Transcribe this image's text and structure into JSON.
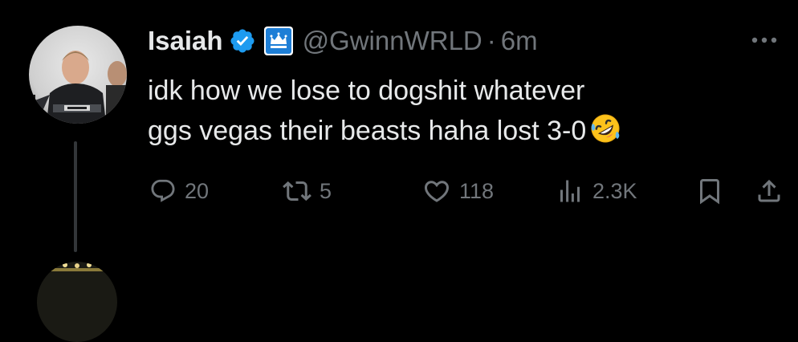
{
  "tweet": {
    "author": {
      "display_name": "Isaiah",
      "handle": "@GwinnWRLD",
      "verified": true,
      "affiliate_badge": "crown-badge"
    },
    "separator": "·",
    "timestamp": "6m",
    "text_lines": [
      "idk how we lose to dogshit whatever",
      "ggs vegas their beasts haha lost 3-0"
    ],
    "emoji": "rolling-on-floor-laughing-emoji",
    "stats": {
      "replies": "20",
      "reposts": "5",
      "likes": "118",
      "views": "2.3K"
    }
  },
  "icons": {
    "more": "more-horizontal-icon",
    "reply": "reply-icon",
    "repost": "repost-icon",
    "like": "heart-icon",
    "views": "views-icon",
    "bookmark": "bookmark-icon",
    "share": "share-icon"
  },
  "colors": {
    "background": "#000000",
    "text_primary": "#e7e9ea",
    "text_secondary": "#71767b",
    "verified_blue": "#1d9bf0",
    "thread_line": "#333639"
  }
}
